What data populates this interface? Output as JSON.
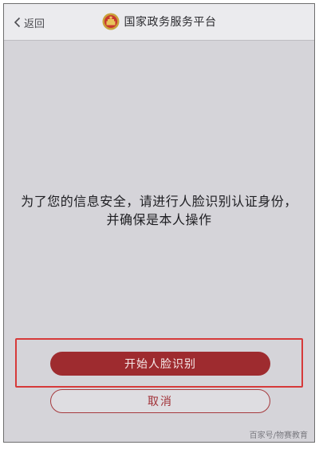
{
  "navbar": {
    "back_label": "返回",
    "title": "国家政务服务平台",
    "emblem_icon": "national-emblem-icon"
  },
  "main": {
    "message": "为了您的信息安全，请进行人脸识别认证身份，并确保是本人操作"
  },
  "actions": {
    "start_label": "开始人脸识别",
    "cancel_label": "取消"
  },
  "watermark": "百家号/物赛教育",
  "colors": {
    "primary": "#9e2b2f",
    "highlight_border": "#d63a3a",
    "background": "#d5d4d9"
  }
}
